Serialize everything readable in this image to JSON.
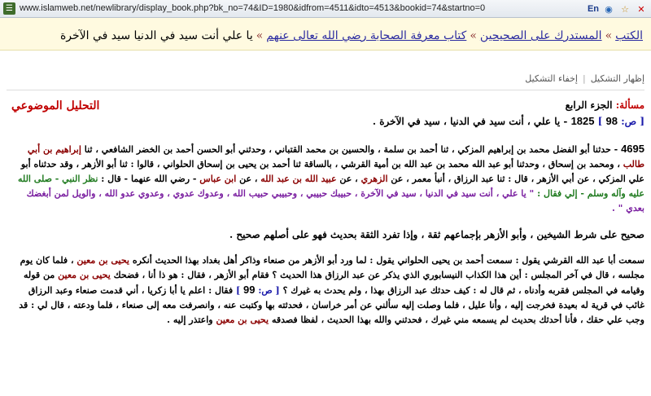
{
  "browser": {
    "url": "www.islamweb.net/newlibrary/display_book.php?bk_no=74&ID=1980&idfrom=4511&idto=4513&bookid=74&startno=0",
    "icons": [
      "site-favicon",
      "lang-translate-icon",
      "globe-icon",
      "star-icon",
      "close-icon"
    ],
    "lang_label": "En"
  },
  "breadcrumb": {
    "home": "الكتب",
    "book": "المستدرك على الصحيحين",
    "section": "كتاب معرفة الصحابة رضي الله تعالى عنهم",
    "current": "يا علي أنت سيد في الدنيا سيد في الآخرة",
    "sep": "»"
  },
  "toolbar": {
    "show_tashkeel": "إظهار التشكيل",
    "hide_tashkeel": "إخفاء التشكيل",
    "divider": "|"
  },
  "header": {
    "masala_label": "مسألة:",
    "part": "الجزء الرابع",
    "topic_link": "التحليل الموضوعي",
    "page_open": "[ ص:",
    "page_no": "98",
    "page_close": "]",
    "hadith_id": "1825",
    "hadith_title": "- يا علي ، أنت سيد في الدنيا ، سيد في الآخرة ."
  },
  "hadith": {
    "number": "4695",
    "p1a": "- حدثنا أبو الفضل محمد بن إبراهيم المزكي ، ثنا أحمد بن سلمة ، والحسين بن محمد القتباني ، وحدثني أبو الحسن أحمد بن الخضر الشافعي ، ثنا",
    "n_ibrahim": "إبراهيم بن أبي طالب",
    "p1b": "، ومحمد بن إسحاق ، وحدثنا أبو عبد الله محمد بن عبد الله بن أمية القرشي ، بالساقة ثنا أحمد بن يحيى بن إسحاق الحلواني ، قالوا : ثنا أبو الأزهر ، وقد حدثناه أبو علي المزكي ، عن أبي الأزهر ، قال : ثنا عبد الرزاق ، أنبأ معمر ، عن",
    "n_zuhri": "الزهري",
    "p1c": "، عن",
    "n_ubaydullah": "عبيد الله بن عبد الله",
    "p1d": "، عن",
    "n_ibnabbas": "ابن عباس",
    "p1e": "- رضي الله عنهما - قال :",
    "prophet": "نظر النبي - صلى الله عليه وآله وسلم - إلي فقال :",
    "quote": "\" يا علي ، أنت سيد في الدنيا ، سيد في الآخرة ، حبيبك حبيبي ، وحبيبي حبيب الله ، وعدوك عدوي ، وعدوي عدو الله ، والويل لمن أبغضك بعدي \" ."
  },
  "grading": "صحيح على شرط الشيخين ، وأبو الأزهر بإجماعهم ثقة ، وإذا تفرد الثقة بحديث فهو على أصلهم صحيح .",
  "commentary": {
    "c1": "سمعت أبا عبد الله القرشي يقول : سمعت أحمد بن يحيى الحلواني يقول : لما ورد أبو الأزهر من صنعاء وذاكر أهل بغداد بهذا الحديث أنكره",
    "n_yahya1": "يحيى بن معين",
    "c2": "، فلما كان يوم مجلسه ، قال في آخر المجلس : أين هذا الكذاب النيسابوري الذي يذكر عن عبد الرزاق هذا الحديث ؟ فقام أبو الأزهر ، فقال : هو ذا أنا ، فضحك",
    "n_yahya2": "يحيى بن معين",
    "c3": "من قوله وقيامه في المجلس فقربه وأدناه ، ثم قال له : كيف حدثك عبد الرزاق بهذا ، ولم يحدث به غيرك ؟",
    "page_open": "[ ص:",
    "page_no": "99",
    "page_close": "]",
    "c4": "فقال : اعلم يا أبا زكريا ، أني قدمت صنعاء وعبد الرزاق غائب في قرية له بعيدة فخرجت إليه ، وأنا عليل ، فلما وصلت إليه سألني عن أمر خراسان ، فحدثته بها وكتبت عنه ، وانصرفت معه إلى صنعاء ، فلما ودعته ، قال لي : قد وجب علي حقك ، فأنا أحدثك بحديث لم يسمعه مني غيرك ، فحدثني والله بهذا الحديث ، لفظا فصدقه",
    "n_yahya3": "يحيى بن معين",
    "c5": "واعتذر إليه ."
  }
}
